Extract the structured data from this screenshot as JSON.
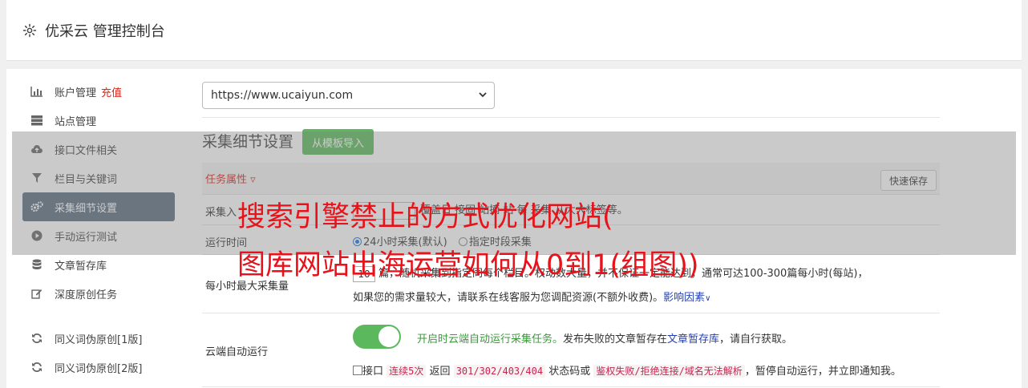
{
  "header": {
    "title": "优采云 管理控制台",
    "icon": "gear-icon"
  },
  "sidebar": {
    "items": [
      {
        "label": "账户管理",
        "extra": "充值",
        "icon": "bar-chart-icon"
      },
      {
        "label": "站点管理",
        "icon": "server-icon"
      },
      {
        "label": "接口文件相关",
        "icon": "cloud-upload-icon"
      },
      {
        "label": "栏目与关键词",
        "icon": "filter-icon"
      },
      {
        "label": "采集细节设置",
        "icon": "cogs-icon",
        "active": true
      },
      {
        "label": "手动运行测试",
        "icon": "play-circle-icon"
      },
      {
        "label": "文章暂存库",
        "icon": "database-icon"
      },
      {
        "label": "深度原创任务",
        "icon": "edit-icon"
      },
      {
        "label": "同义词伪原创[1版]",
        "icon": "refresh-icon"
      },
      {
        "label": "同义词伪原创[2版]",
        "icon": "refresh-icon"
      }
    ]
  },
  "main": {
    "site_select": "https://www.ucaiyun.com",
    "section_title": "采集细节设置",
    "template_button": "从模板导入",
    "table": {
      "attr_header": "任务属性 ▿",
      "quick_save": "快速保存",
      "rows": {
        "collect_label": "采集入",
        "collect_tail": "覆盖日 接固 站摘 站 每 采集 从大大标签等。",
        "run_time_label": "运行时间",
        "run_opt_1": "24小时采集(默认)",
        "run_opt_2": "指定时段采集",
        "max_label": "每小时最大采集量",
        "max_value": "10",
        "max_desc_1": "篇，随机采集到指定同每个栏目。权动数大量，并不保证一定能达到，通常可达100-300篇每小时(每站)，",
        "max_desc_2": "如果您的需求量较大，请联系在线客服为您调配资源(不额外收费)。",
        "max_link": "影响因素",
        "cloud_label": "云端自动运行",
        "cloud_green": "开启时云端自动运行采集任务。",
        "cloud_desc": "发布失败的文章暂存在",
        "cloud_link": "文章暂存库",
        "cloud_tail": "，请自行获取。",
        "api_prefix": "接口",
        "api_code_1": "连续5次",
        "api_mid_1": "返回",
        "api_code_2": "301/302/403/404",
        "api_mid_2": "状态码或",
        "api_code_3": "鉴权失败/拒绝连接/域名无法解析",
        "api_tail": "，暂停自动运行，并立即通知我。"
      }
    }
  },
  "overlay": {
    "line1": "搜索引擎禁止的方式优化网站(",
    "line2": "图库网站出海运营如何从0到1(组图))"
  },
  "colors": {
    "accent_green": "#5cb85c",
    "red": "#d9261c",
    "active_sidebar": "#5b6d80"
  }
}
